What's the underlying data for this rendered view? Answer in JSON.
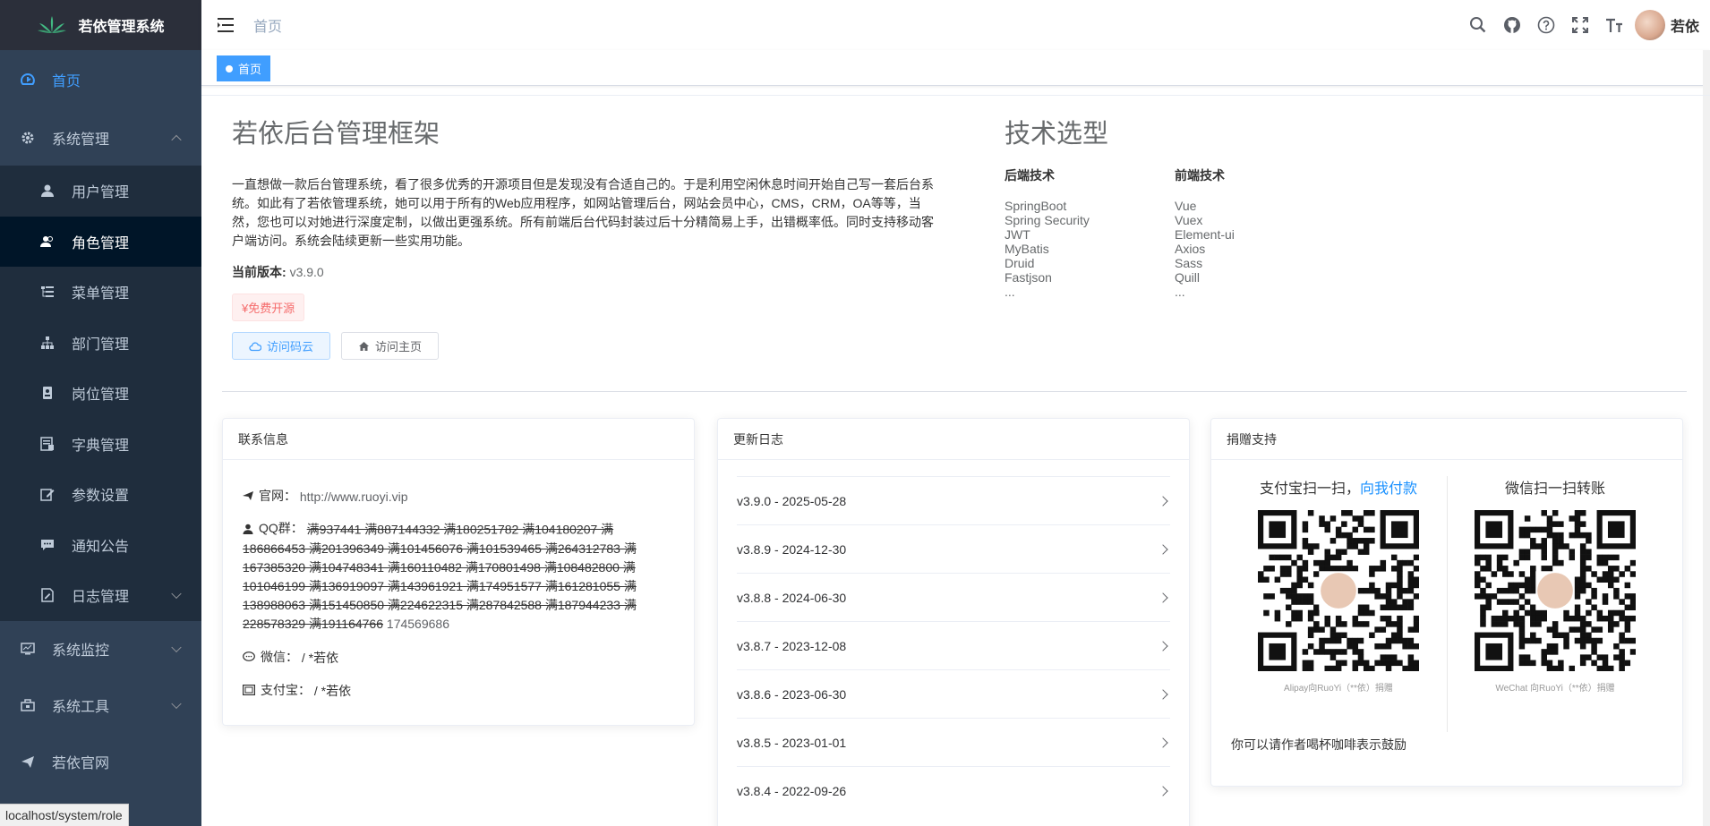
{
  "app": {
    "title": "若依管理系统",
    "user_name": "若依"
  },
  "sidebar": {
    "home": "首页",
    "system": "系统管理",
    "sub_items": [
      {
        "label": "用户管理"
      },
      {
        "label": "角色管理"
      },
      {
        "label": "菜单管理"
      },
      {
        "label": "部门管理"
      },
      {
        "label": "岗位管理"
      },
      {
        "label": "字典管理"
      },
      {
        "label": "参数设置"
      },
      {
        "label": "通知公告"
      },
      {
        "label": "日志管理"
      }
    ],
    "monitor": "系统监控",
    "tools": "系统工具",
    "site": "若依官网"
  },
  "status_bar": "localhost/system/role",
  "navbar": {
    "breadcrumb": "首页"
  },
  "tags": {
    "home": "首页"
  },
  "intro": {
    "title": "若依后台管理框架",
    "description": "一直想做一款后台管理系统，看了很多优秀的开源项目但是发现没有合适自己的。于是利用空闲休息时间开始自己写一套后台系统。如此有了若依管理系统，她可以用于所有的Web应用程序，如网站管理后台，网站会员中心，CMS，CRM，OA等等，当然，您也可以对她进行深度定制，以做出更强系统。所有前端后台代码封装过后十分精简易上手，出错概率低。同时支持移动客户端访问。系统会陆续更新一些实用功能。",
    "version_label": "当前版本:",
    "version": "v3.9.0",
    "badge": "¥免费开源",
    "btn_gitee": "访问码云",
    "btn_home": "访问主页"
  },
  "tech": {
    "title": "技术选型",
    "backend_title": "后端技术",
    "backend": [
      "SpringBoot",
      "Spring Security",
      "JWT",
      "MyBatis",
      "Druid",
      "Fastjson",
      "..."
    ],
    "frontend_title": "前端技术",
    "frontend": [
      "Vue",
      "Vuex",
      "Element-ui",
      "Axios",
      "Sass",
      "Quill",
      "..."
    ]
  },
  "contact": {
    "header": "联系信息",
    "site_label": "官网：",
    "site_url": "http://www.ruoyi.vip",
    "qq_label": "QQ群：",
    "qq_struck": "满937441 满887144332 满180251782 满104180207 满186866453 满201396349 满101456076 满101539465 满264312783 满167385320 满104748341 满160110482 满170801498 满108482800 满101046199 满136919097 满143961921 满174951577 满161281055 满138988063 满151450850 满224622315 满287842588 满187944233 满228578329 满191164766",
    "qq_last": "174569686",
    "wechat_label": "微信：",
    "wechat_value": "/ *若依",
    "alipay_label": "支付宝：",
    "alipay_value": "/ *若依"
  },
  "changelog": {
    "header": "更新日志",
    "items": [
      "v3.9.0 - 2025-05-28",
      "v3.8.9 - 2024-12-30",
      "v3.8.8 - 2024-06-30",
      "v3.8.7 - 2023-12-08",
      "v3.8.6 - 2023-06-30",
      "v3.8.5 - 2023-01-01",
      "v3.8.4 - 2022-09-26"
    ]
  },
  "donate": {
    "header": "捐赠支持",
    "alipay_title_a": "支付宝扫一扫，",
    "alipay_title_link": "向我付款",
    "alipay_caption": "Alipay向RuoYi（**依）捐赠",
    "wechat_title": "微信扫一扫转账",
    "wechat_caption": "WeChat 向RuoYi（**依）捐赠",
    "footer": "你可以请作者喝杯咖啡表示鼓励"
  },
  "colors": {
    "sidebar": "#304156",
    "primary": "#409eff",
    "submenu": "#1f2d3d"
  }
}
